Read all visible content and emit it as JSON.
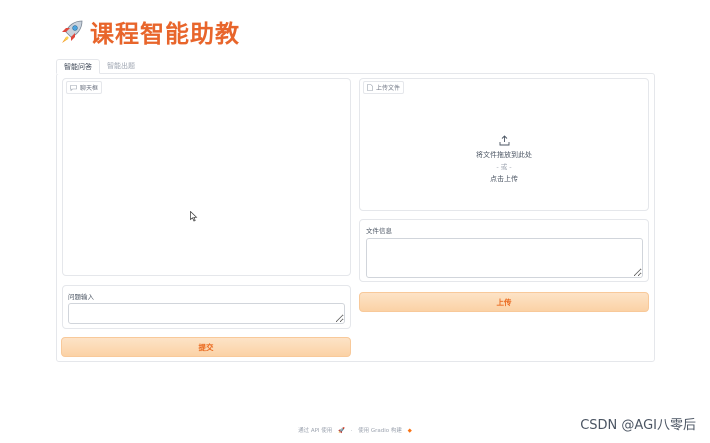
{
  "app": {
    "title": "课程智能助教",
    "title_icon": "rocket-icon"
  },
  "tabs": [
    {
      "label": "智能问答",
      "active": true
    },
    {
      "label": "智能出题",
      "active": false
    }
  ],
  "chatbot": {
    "label": "聊天框",
    "icon": "chat-icon"
  },
  "question": {
    "label": "问题输入",
    "value": ""
  },
  "submit": {
    "label": "提交"
  },
  "upload": {
    "label": "上传文件",
    "icon": "file-icon",
    "drop_text": "将文件拖放到此处",
    "or_text": "- 或 -",
    "click_text": "点击上传"
  },
  "file_info": {
    "label": "文件信息",
    "value": ""
  },
  "upload_button": {
    "label": "上传"
  },
  "footer": {
    "api_text": "通过 API 使用",
    "separator": "·",
    "built_text": "使用 Gradio 构建"
  },
  "watermark": "CSDN @AGI八零后",
  "colors": {
    "accent": "#e8652b",
    "button_bg": "#fbd2a5"
  }
}
